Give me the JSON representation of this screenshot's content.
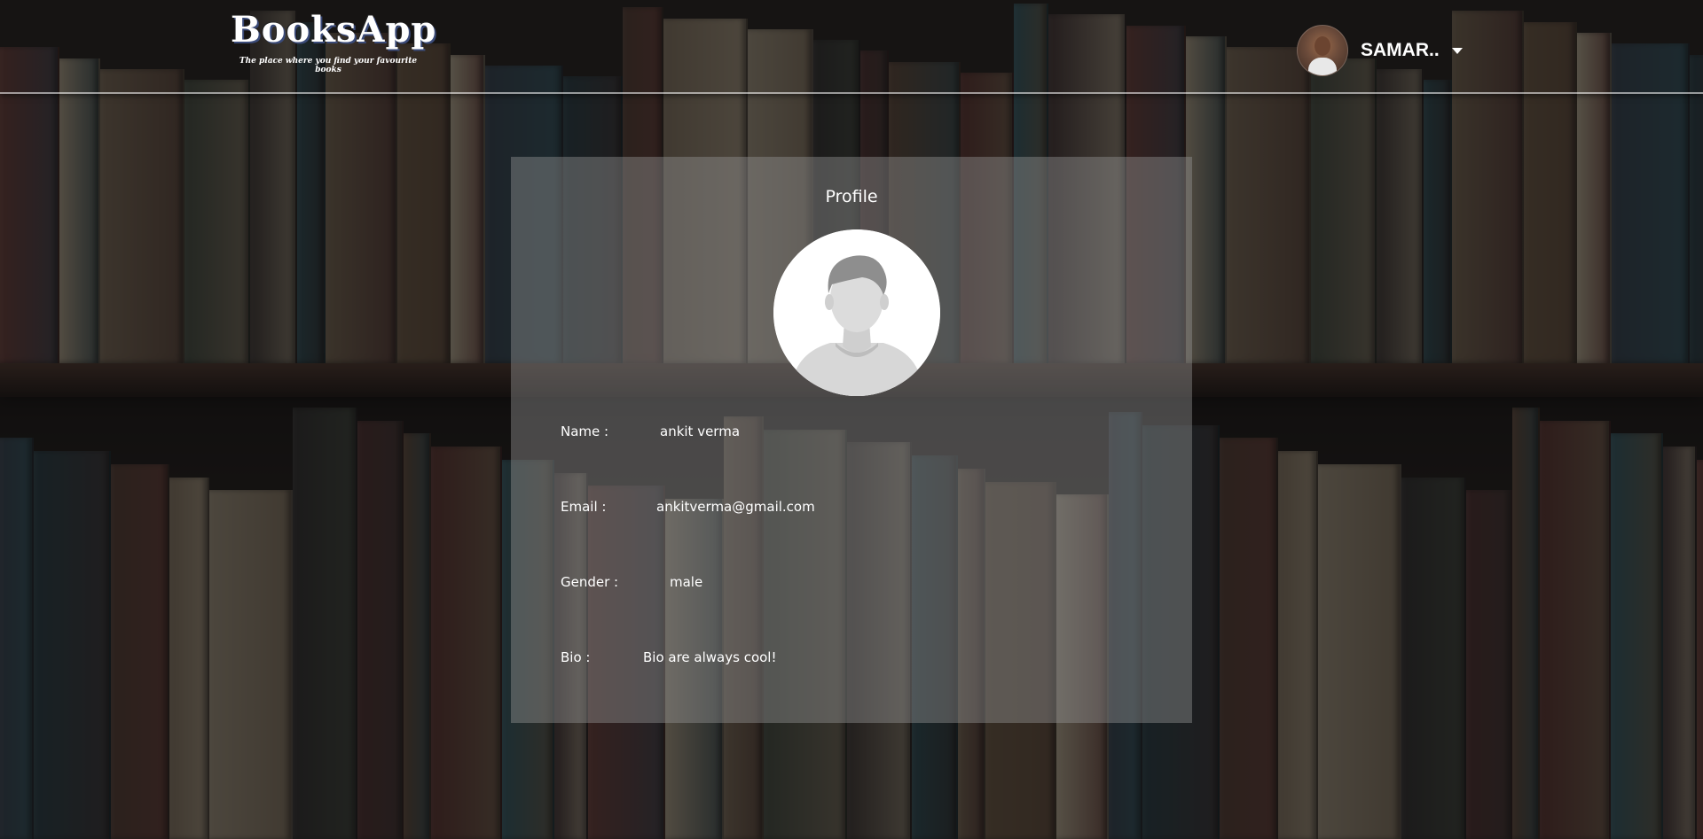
{
  "header": {
    "brand_title": "BooksApp",
    "brand_tagline": "The place where you find your favourite books",
    "user_name": "SAMAR..",
    "user_menu_icon": "caret-down-icon"
  },
  "profile": {
    "title": "Profile",
    "avatar_icon": "default-user-avatar-icon",
    "fields": [
      {
        "label": "Name :",
        "value": "ankit verma"
      },
      {
        "label": "Email :",
        "value": "ankitverma@gmail.com"
      },
      {
        "label": "Gender :",
        "value": "male"
      },
      {
        "label": "Bio :",
        "value": "Bio are always cool!"
      }
    ]
  },
  "colors": {
    "header_border": "#d9d9d9",
    "card_background": "rgba(150,150,150,0.42)",
    "text": "#ffffff"
  }
}
